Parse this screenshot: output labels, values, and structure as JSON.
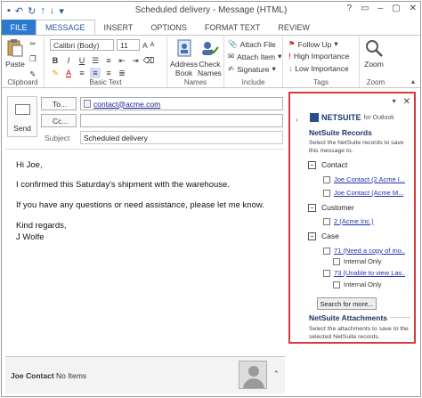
{
  "window": {
    "title": "Scheduled delivery - Message (HTML)",
    "controls": [
      "?",
      "▭",
      "–",
      "▢",
      "✕"
    ]
  },
  "tabs": [
    "FILE",
    "MESSAGE",
    "INSERT",
    "OPTIONS",
    "FORMAT TEXT",
    "REVIEW"
  ],
  "ribbon": {
    "clipboard": {
      "paste": "Paste",
      "label": "Clipboard"
    },
    "basic_text": {
      "font": "Calibri (Body)",
      "size": "11",
      "label": "Basic Text"
    },
    "names": {
      "address_book": [
        "Address",
        "Book"
      ],
      "check_names": [
        "Check",
        "Names"
      ],
      "label": "Names"
    },
    "include": {
      "attach_file": "Attach File",
      "attach_item": "Attach Item",
      "signature": "Signature",
      "label": "Include"
    },
    "tags": {
      "follow_up": "Follow Up",
      "high": "High Importance",
      "low": "Low Importance",
      "label": "Tags"
    },
    "zoom": {
      "button": "Zoom",
      "label": "Zoom"
    }
  },
  "compose": {
    "send": "Send",
    "to_label": "To...",
    "to_value": "contact@acme.com",
    "cc_label": "Cc...",
    "cc_value": "",
    "subject_label": "Subject",
    "subject_value": "Scheduled delivery"
  },
  "body": {
    "lines": [
      "Hi Joe,",
      "I confirmed this Saturday's shipment with the warehouse.",
      "If you have any questions or need assistance, please let me know.",
      "Kind regards,",
      "J Wolfe"
    ]
  },
  "people_pane": {
    "name": "Joe Contact",
    "items": "No Items"
  },
  "netsuite": {
    "brand": "NETSUITE",
    "for": "for Outlook",
    "records_title": "NetSuite Records",
    "records_desc": "Select the NetSuite records to save this message to.",
    "contact_label": "Contact",
    "contacts": [
      "Joe Contact (2 Acme I...",
      "Joe Contact (Acme M..."
    ],
    "customer_label": "Customer",
    "customers": [
      "2 (Acme Inc.)"
    ],
    "case_label": "Case",
    "cases": [
      "71 (Need a copy of mo...",
      "73 (Unable to view Las..."
    ],
    "internal_only": "Internal Only",
    "search_button": "Search for more...",
    "attach_title": "NetSuite Attachments",
    "attach_desc": "Select the attachments to save to the selected NetSuite records."
  },
  "colors": {
    "file_tab": "#2b7ad0",
    "accent": "#2b579a",
    "highlight_border": "#d63a3a",
    "ns_blue": "#1e3463"
  }
}
